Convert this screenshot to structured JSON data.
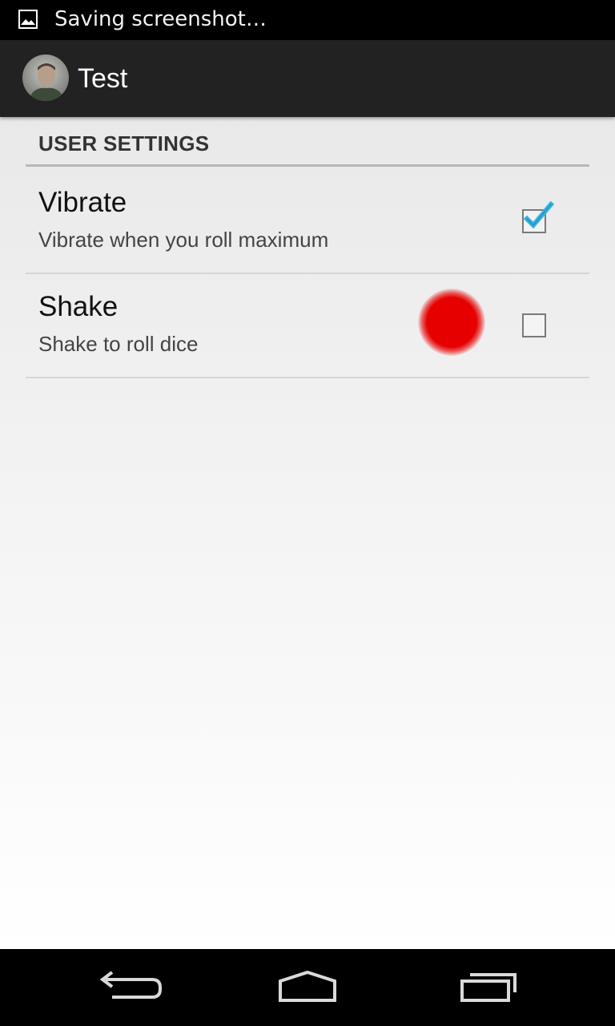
{
  "status_bar": {
    "notification_icon": "image-icon",
    "text": "Saving screenshot…"
  },
  "action_bar": {
    "avatar_icon": "profile-photo",
    "title": "Test"
  },
  "settings": {
    "category_header": "USER SETTINGS",
    "items": [
      {
        "title": "Vibrate",
        "summary": "Vibrate when you roll maximum",
        "checked": true
      },
      {
        "title": "Shake",
        "summary": "Shake to roll dice",
        "checked": false
      }
    ]
  },
  "touch_indicator": {
    "color": "#e60000"
  },
  "nav_bar": {
    "buttons": [
      "back-icon",
      "home-icon",
      "recent-apps-icon"
    ]
  },
  "colors": {
    "accent": "#33b5e5",
    "action_bar_bg": "#222222"
  }
}
